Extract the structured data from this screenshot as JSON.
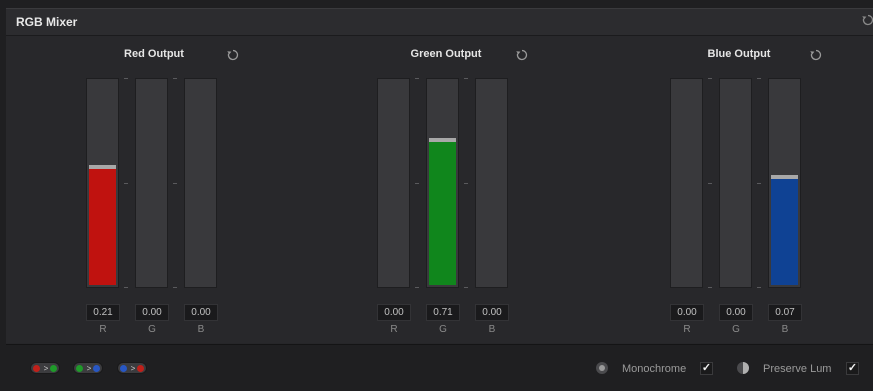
{
  "panel": {
    "title": "RGB Mixer"
  },
  "groups": [
    {
      "label": "Red Output",
      "channels": [
        {
          "label": "R",
          "value": "0.21",
          "level": 0.57,
          "color": "#c0120f"
        },
        {
          "label": "G",
          "value": "0.00",
          "level": 0.0,
          "color": "#1f8b1f"
        },
        {
          "label": "B",
          "value": "0.00",
          "level": 0.0,
          "color": "#1746a0"
        }
      ]
    },
    {
      "label": "Green Output",
      "channels": [
        {
          "label": "R",
          "value": "0.00",
          "level": 0.0,
          "color": "#c0120f"
        },
        {
          "label": "G",
          "value": "0.71",
          "level": 0.7,
          "color": "#10861c"
        },
        {
          "label": "B",
          "value": "0.00",
          "level": 0.0,
          "color": "#1746a0"
        }
      ]
    },
    {
      "label": "Blue Output",
      "channels": [
        {
          "label": "R",
          "value": "0.00",
          "level": 0.0,
          "color": "#c0120f"
        },
        {
          "label": "G",
          "value": "0.00",
          "level": 0.0,
          "color": "#1f8b1f"
        },
        {
          "label": "B",
          "value": "0.07",
          "level": 0.52,
          "color": "#0f4294"
        }
      ]
    }
  ],
  "footer": {
    "presets": [
      {
        "name": "red-to-green",
        "from": "#c0201a",
        "to": "#1f9a2a"
      },
      {
        "name": "green-to-blue",
        "from": "#1f9a2a",
        "to": "#2857c4"
      },
      {
        "name": "blue-to-red",
        "from": "#2857c4",
        "to": "#c0201a"
      }
    ],
    "monochrome_label": "Monochrome",
    "monochrome_checked": "✓",
    "preserve_lum_label": "Preserve Lum",
    "preserve_lum_checked": "✓"
  }
}
